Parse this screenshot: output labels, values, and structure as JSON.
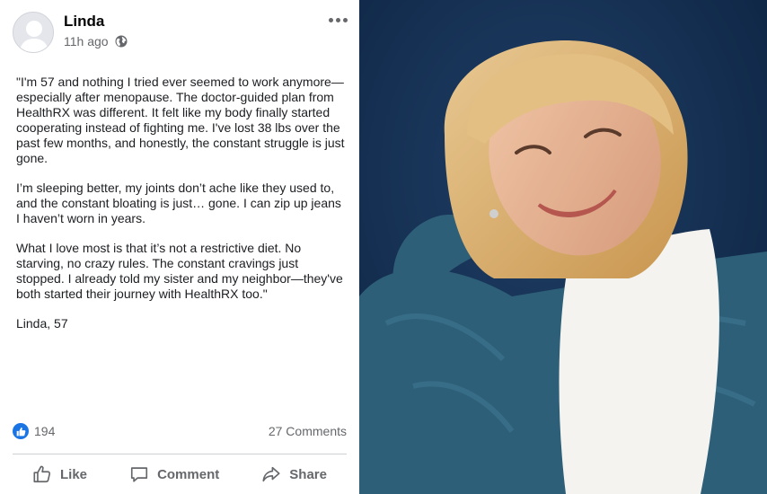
{
  "post": {
    "author": "Linda",
    "time": "11h ago",
    "paragraphs": [
      "\"I'm 57 and nothing I tried ever seemed to work anymore—especially after menopause. The doctor-guided plan from HealthRX was different. It felt like my body finally started cooperating instead of fighting me. I've lost 38 lbs over the past few months, and honestly, the constant struggle is just gone.",
      "I’m sleeping better, my joints don’t ache like they used to, and the constant bloating is just… gone. I can zip up jeans I haven’t worn in years.",
      "What I love most is that it’s not a restrictive diet. No starving, no crazy rules. The constant cravings just stopped. I already told my sister and my neighbor—they've both started their journey with HealthRX too.\""
    ],
    "signature": "Linda, 57",
    "likes": "194",
    "comments": "27 Comments",
    "actions": {
      "like": "Like",
      "comment": "Comment",
      "share": "Share"
    }
  },
  "icons": {
    "avatar": "default-user-avatar-icon",
    "audience": "globe-icon",
    "more": "more-options-icon",
    "reaction": "thumbs-up-icon",
    "like": "thumbs-up-outline-icon",
    "comment": "speech-bubble-icon",
    "share": "share-arrow-icon"
  },
  "colors": {
    "brand_blue": "#1b74e4",
    "muted_text": "#65676b",
    "photo_background": "#0f2a4a"
  }
}
